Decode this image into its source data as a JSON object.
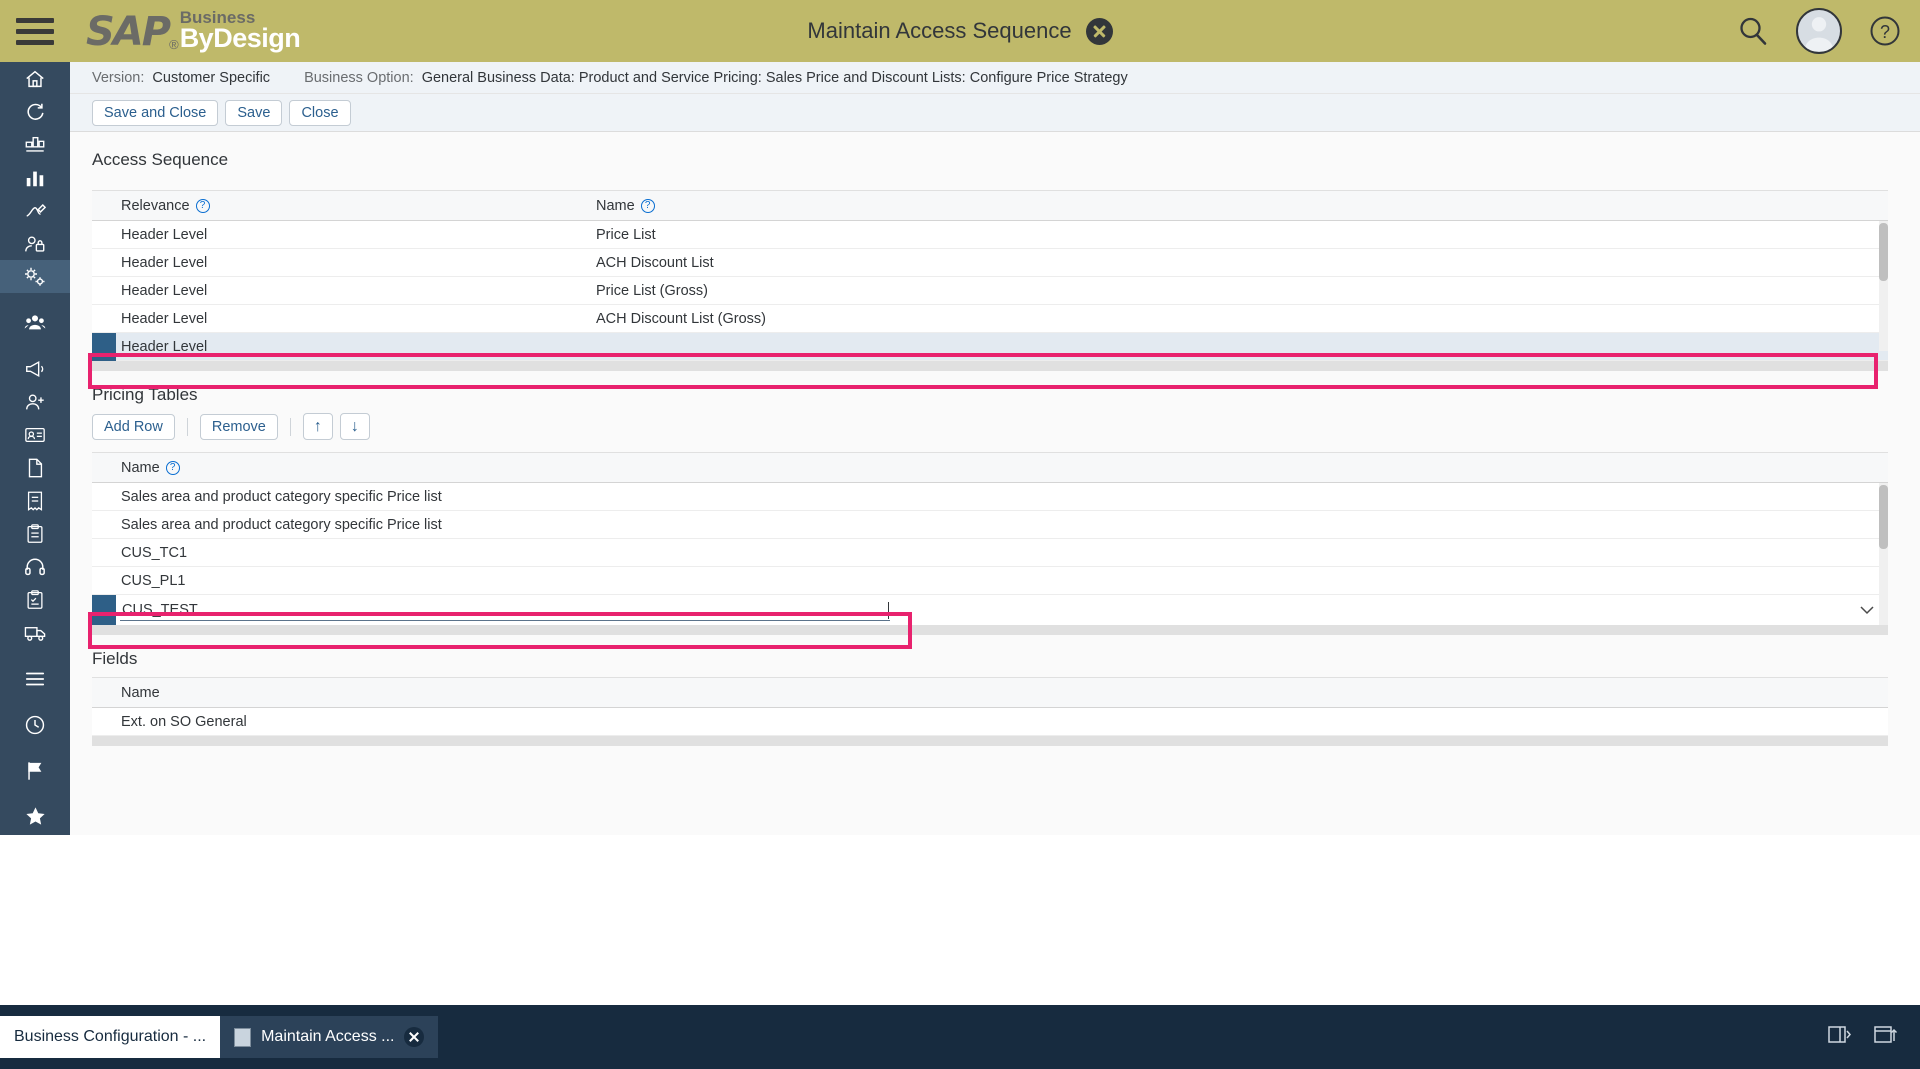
{
  "header": {
    "menu_icon": "hamburger-menu-icon",
    "logo_sap": "SAP",
    "logo_reg": "®",
    "logo_business": "Business",
    "logo_bydesign": "ByDesign",
    "logo_tm": "˙",
    "title": "Maintain Access Sequence",
    "close_icon": "close-icon",
    "search_icon": "search-icon",
    "avatar_icon": "user-avatar-icon",
    "help_icon": "help-icon",
    "bg_color": "#bfb96a"
  },
  "sidebar": {
    "bg_color": "#354a5f",
    "items": [
      {
        "name": "home-icon",
        "glyph": "home"
      },
      {
        "name": "refresh-icon",
        "glyph": "refresh"
      },
      {
        "name": "dashboard-icon",
        "glyph": "dashboard"
      },
      {
        "name": "analytics-icon",
        "glyph": "bars"
      },
      {
        "name": "signature-icon",
        "glyph": "pen"
      },
      {
        "name": "access-rights-icon",
        "glyph": "lockuser"
      },
      {
        "name": "business-configuration-icon",
        "glyph": "gear-people",
        "active": true
      },
      {
        "name": "people-icon",
        "glyph": "people"
      },
      {
        "name": "campaign-icon",
        "glyph": "megaphone"
      },
      {
        "name": "contact-icon",
        "glyph": "personplus"
      },
      {
        "name": "id-card-icon",
        "glyph": "idcard"
      },
      {
        "name": "document-icon",
        "glyph": "doc"
      },
      {
        "name": "invoice-icon",
        "glyph": "invoice"
      },
      {
        "name": "clipboard-icon",
        "glyph": "clipboard"
      },
      {
        "name": "headset-icon",
        "glyph": "headset"
      },
      {
        "name": "tasks-icon",
        "glyph": "tasks"
      },
      {
        "name": "delivery-icon",
        "glyph": "truck"
      },
      {
        "name": "list-icon",
        "glyph": "list"
      },
      {
        "name": "clock-icon",
        "glyph": "clock"
      },
      {
        "name": "flag-icon",
        "glyph": "flag"
      },
      {
        "name": "star-icon",
        "glyph": "star"
      },
      {
        "name": "books-icon",
        "glyph": "books"
      }
    ]
  },
  "infobar": {
    "version_label": "Version:",
    "version_value": "Customer Specific",
    "option_label": "Business Option:",
    "option_value": "General Business Data: Product and Service Pricing: Sales Price and Discount Lists: Configure Price Strategy"
  },
  "toolbar": {
    "save_and_close_label": "Save and Close",
    "save_label": "Save",
    "close_label": "Close"
  },
  "access_sequence": {
    "title": "Access Sequence",
    "columns": [
      {
        "label": "Relevance",
        "help": "?"
      },
      {
        "label": "Name",
        "help": "?"
      }
    ],
    "rows": [
      {
        "relevance": "Header Level",
        "name": "Price List",
        "selected": false
      },
      {
        "relevance": "Header Level",
        "name": "ACH Discount List",
        "selected": false
      },
      {
        "relevance": "Header Level",
        "name": "Price List (Gross)",
        "selected": false
      },
      {
        "relevance": "Header Level",
        "name": "ACH Discount List (Gross)",
        "selected": false
      },
      {
        "relevance": "Header Level",
        "name": "",
        "selected": true
      }
    ]
  },
  "pricing_tables": {
    "title": "Pricing Tables",
    "add_row_label": "Add Row",
    "remove_label": "Remove",
    "move_up_icon": "arrow-up-icon",
    "move_down_icon": "arrow-down-icon",
    "move_up_glyph": "↑",
    "move_down_glyph": "↓",
    "columns": [
      {
        "label": "Name",
        "help": "?"
      }
    ],
    "rows": [
      {
        "name": "Sales area and product category specific Price list",
        "editing": false
      },
      {
        "name": "Sales area and product category specific Price list",
        "editing": false
      },
      {
        "name": "CUS_TC1",
        "editing": false
      },
      {
        "name": "CUS_PL1",
        "editing": false
      }
    ],
    "edit_row": {
      "value": "CUS_TEST",
      "placeholder": "",
      "dropdown_icon": "chevron-down-icon",
      "dropdown_glyph": "⌄"
    }
  },
  "fields": {
    "title": "Fields",
    "columns": [
      {
        "label": "Name"
      }
    ],
    "rows": [
      {
        "name": "Ext. on SO General"
      }
    ]
  },
  "annotations": {
    "color": "#e8226e",
    "boxes": [
      {
        "name": "selected-access-sequence-row-highlight"
      },
      {
        "name": "pricing-table-input-highlight"
      }
    ]
  },
  "taskbar": {
    "bg_color": "#172b3f",
    "items": [
      {
        "label": "Business Configuration - ...",
        "active": true,
        "closable": false,
        "icon": ""
      },
      {
        "label": "Maintain Access ...",
        "active": false,
        "closable": true,
        "icon": "document-icon"
      }
    ],
    "right_icons": [
      {
        "name": "side-panel-icon"
      },
      {
        "name": "open-in-new-window-icon"
      }
    ]
  }
}
